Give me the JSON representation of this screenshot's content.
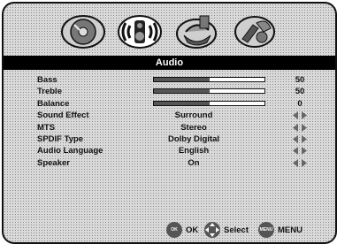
{
  "menu": {
    "title": "Audio",
    "icons": [
      {
        "name": "picture-disc-icon",
        "active": false
      },
      {
        "name": "audio-speaker-icon",
        "active": true
      },
      {
        "name": "channel-dish-icon",
        "active": false
      },
      {
        "name": "setup-tools-icon",
        "active": false
      }
    ]
  },
  "rows": [
    {
      "label": "Bass",
      "type": "slider",
      "value": "50",
      "level": 0.5
    },
    {
      "label": "Treble",
      "type": "slider",
      "value": "50",
      "level": 0.5
    },
    {
      "label": "Balance",
      "type": "slider",
      "value": "0",
      "level": 0.5
    },
    {
      "label": "Sound Effect",
      "type": "option",
      "value": "Surround"
    },
    {
      "label": "MTS",
      "type": "option",
      "value": "Stereo"
    },
    {
      "label": "SPDIF Type",
      "type": "option",
      "value": "Dolby Digital"
    },
    {
      "label": "Audio Language",
      "type": "option",
      "value": "English"
    },
    {
      "label": "Speaker",
      "type": "option",
      "value": "On"
    }
  ],
  "footer": {
    "ok_icon_text": "OK",
    "ok_label": "OK",
    "select_label": "Select",
    "menu_icon_text": "MENU",
    "menu_label": "MENU"
  }
}
